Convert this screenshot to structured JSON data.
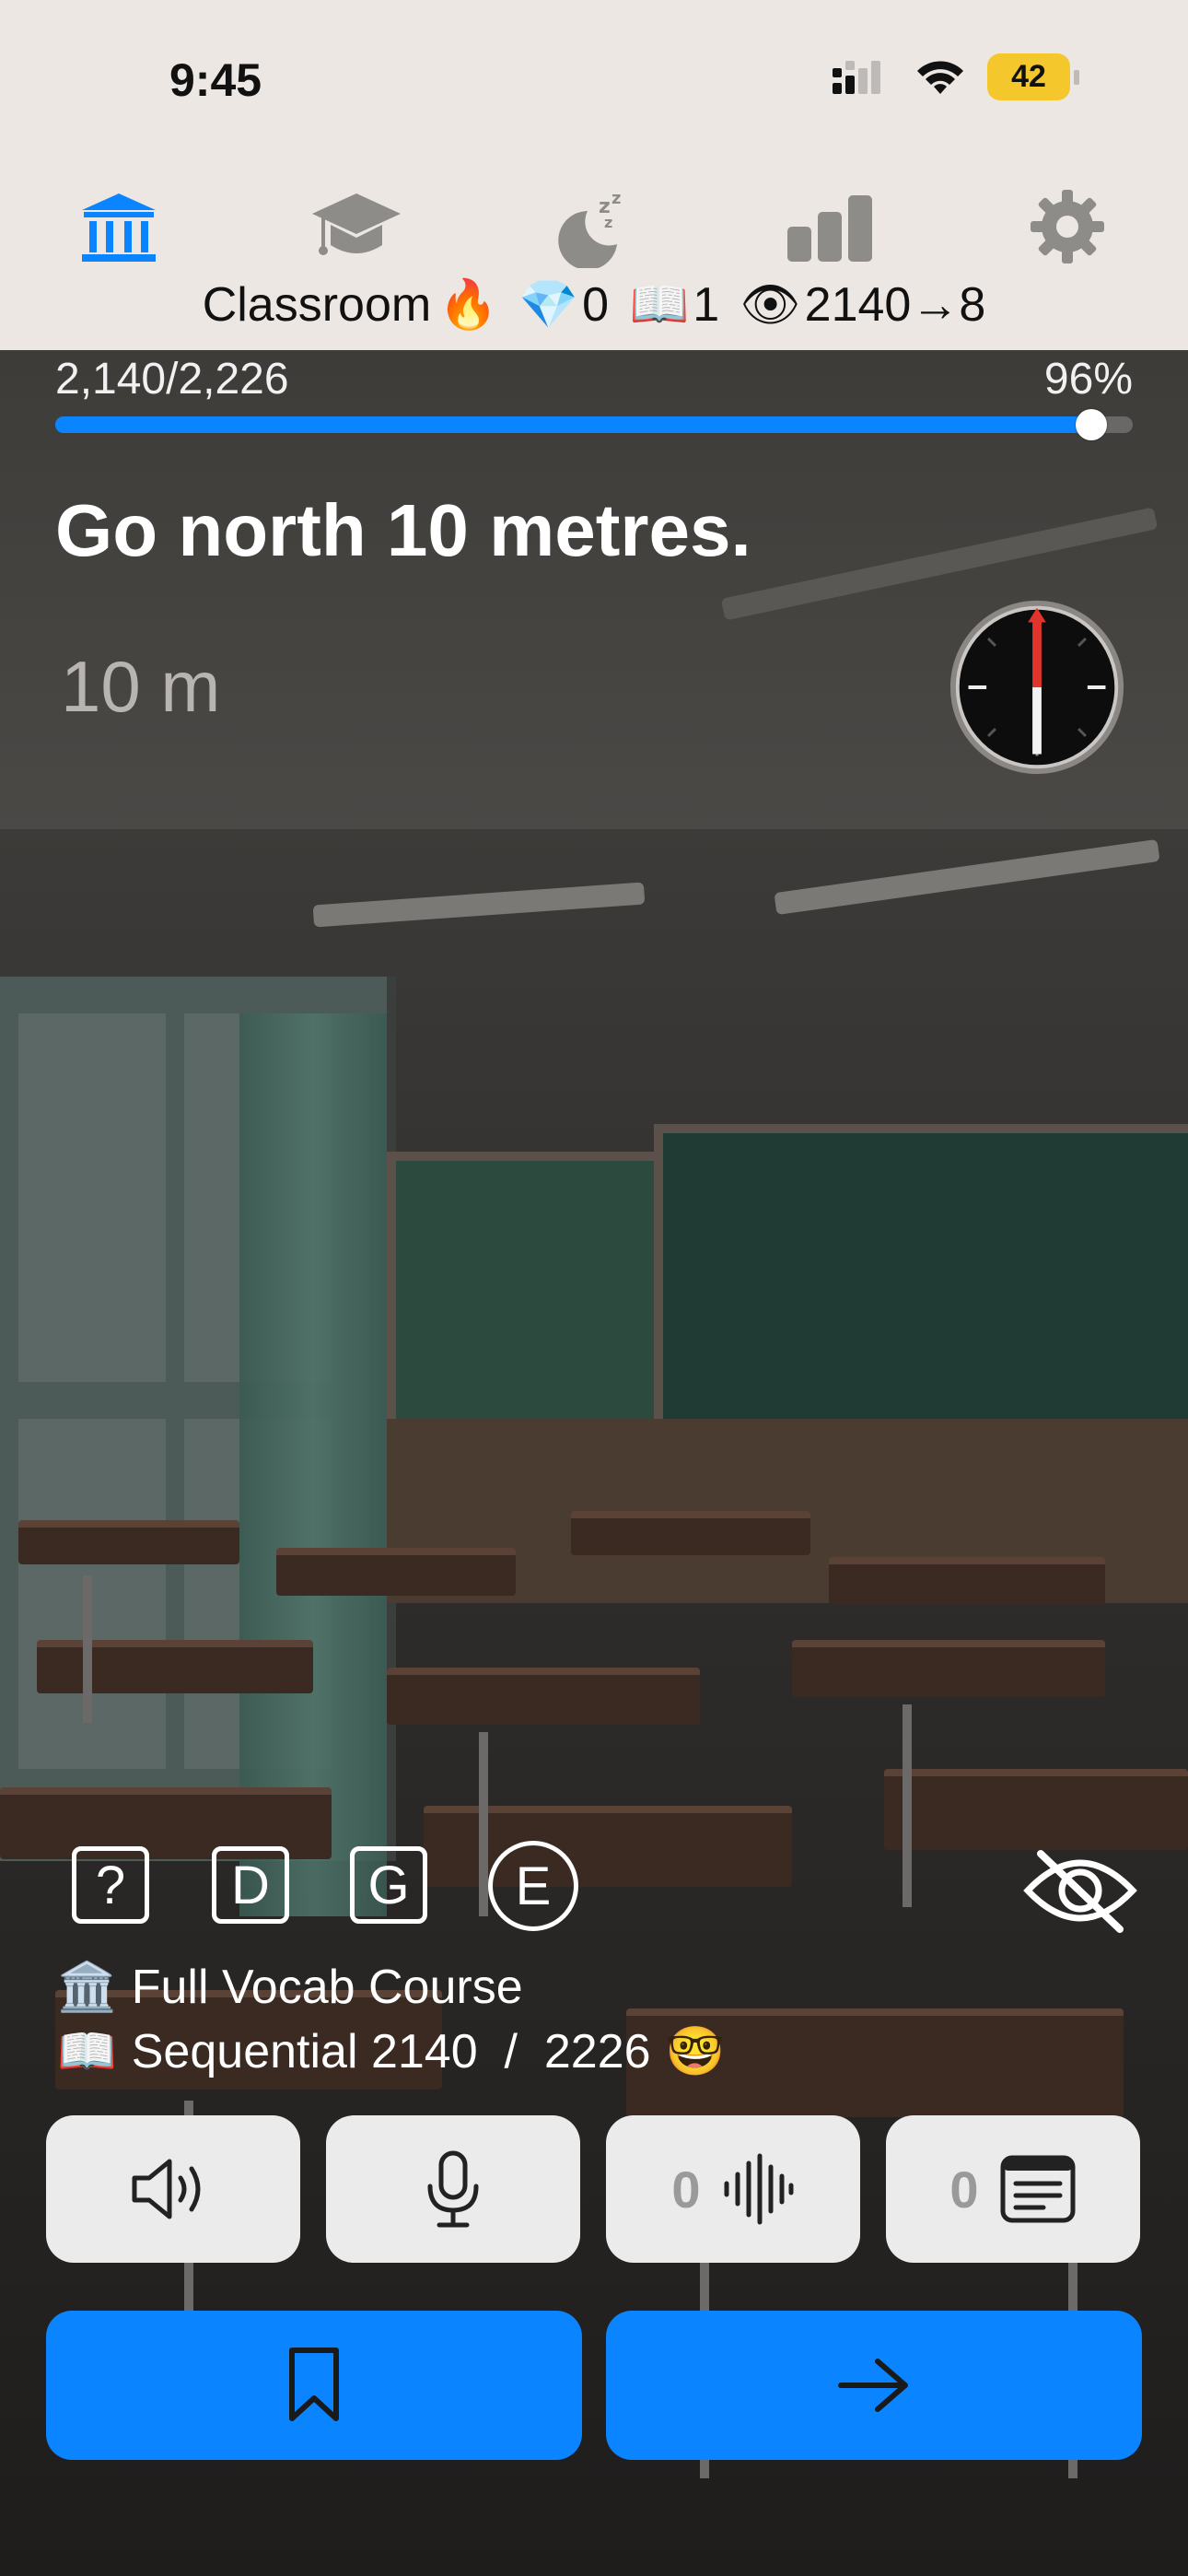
{
  "status_bar": {
    "time": "9:45",
    "battery": "42"
  },
  "tabs": [
    {
      "name": "Classroom",
      "icon": "bank-icon",
      "active": true
    },
    {
      "name": "Course",
      "icon": "graduation-cap-icon",
      "active": false
    },
    {
      "name": "Sleep",
      "icon": "moon-zzz-icon",
      "active": false
    },
    {
      "name": "Stats",
      "icon": "bar-chart-icon",
      "active": false
    },
    {
      "name": "Settings",
      "icon": "gear-icon",
      "active": false
    }
  ],
  "header": {
    "title": "Classroom",
    "fire": "🔥",
    "gem_icon": "💎",
    "gems": "0",
    "book_icon": "📖",
    "books": "1",
    "eye_icon": "👁",
    "views": "2140→8"
  },
  "progress": {
    "count_label": "2,140/2,226",
    "percent_label": "96%",
    "current": 2140,
    "total": 2226,
    "fraction": 0.96,
    "color": "#0a84ff"
  },
  "instruction": {
    "text": "Go north 10 metres.",
    "distance": "10 m"
  },
  "compass": {
    "icon": "compass-icon"
  },
  "options": [
    {
      "label": "?",
      "shape": "square"
    },
    {
      "label": "D",
      "shape": "square"
    },
    {
      "label": "G",
      "shape": "square"
    },
    {
      "label": "E",
      "shape": "circle"
    }
  ],
  "visibility_toggle": {
    "icon": "eye-slash-icon"
  },
  "course": {
    "course_icon": "🏛️",
    "name": "Full Vocab Course",
    "mode_icon": "📖",
    "mode_line": "Sequential 2140  /  2226",
    "emoji": "🤓"
  },
  "actions": {
    "speaker": {
      "icon": "speaker-icon"
    },
    "mic": {
      "icon": "microphone-icon"
    },
    "waveform": {
      "count": "0",
      "icon": "waveform-icon"
    },
    "notes": {
      "count": "0",
      "icon": "notes-icon"
    }
  },
  "bottom": {
    "bookmark": {
      "icon": "bookmark-icon"
    },
    "next": {
      "icon": "arrow-right-icon"
    }
  },
  "colors": {
    "accent": "#0a84ff",
    "top_bg": "#ece7e3",
    "battery": "#f4c82c"
  }
}
